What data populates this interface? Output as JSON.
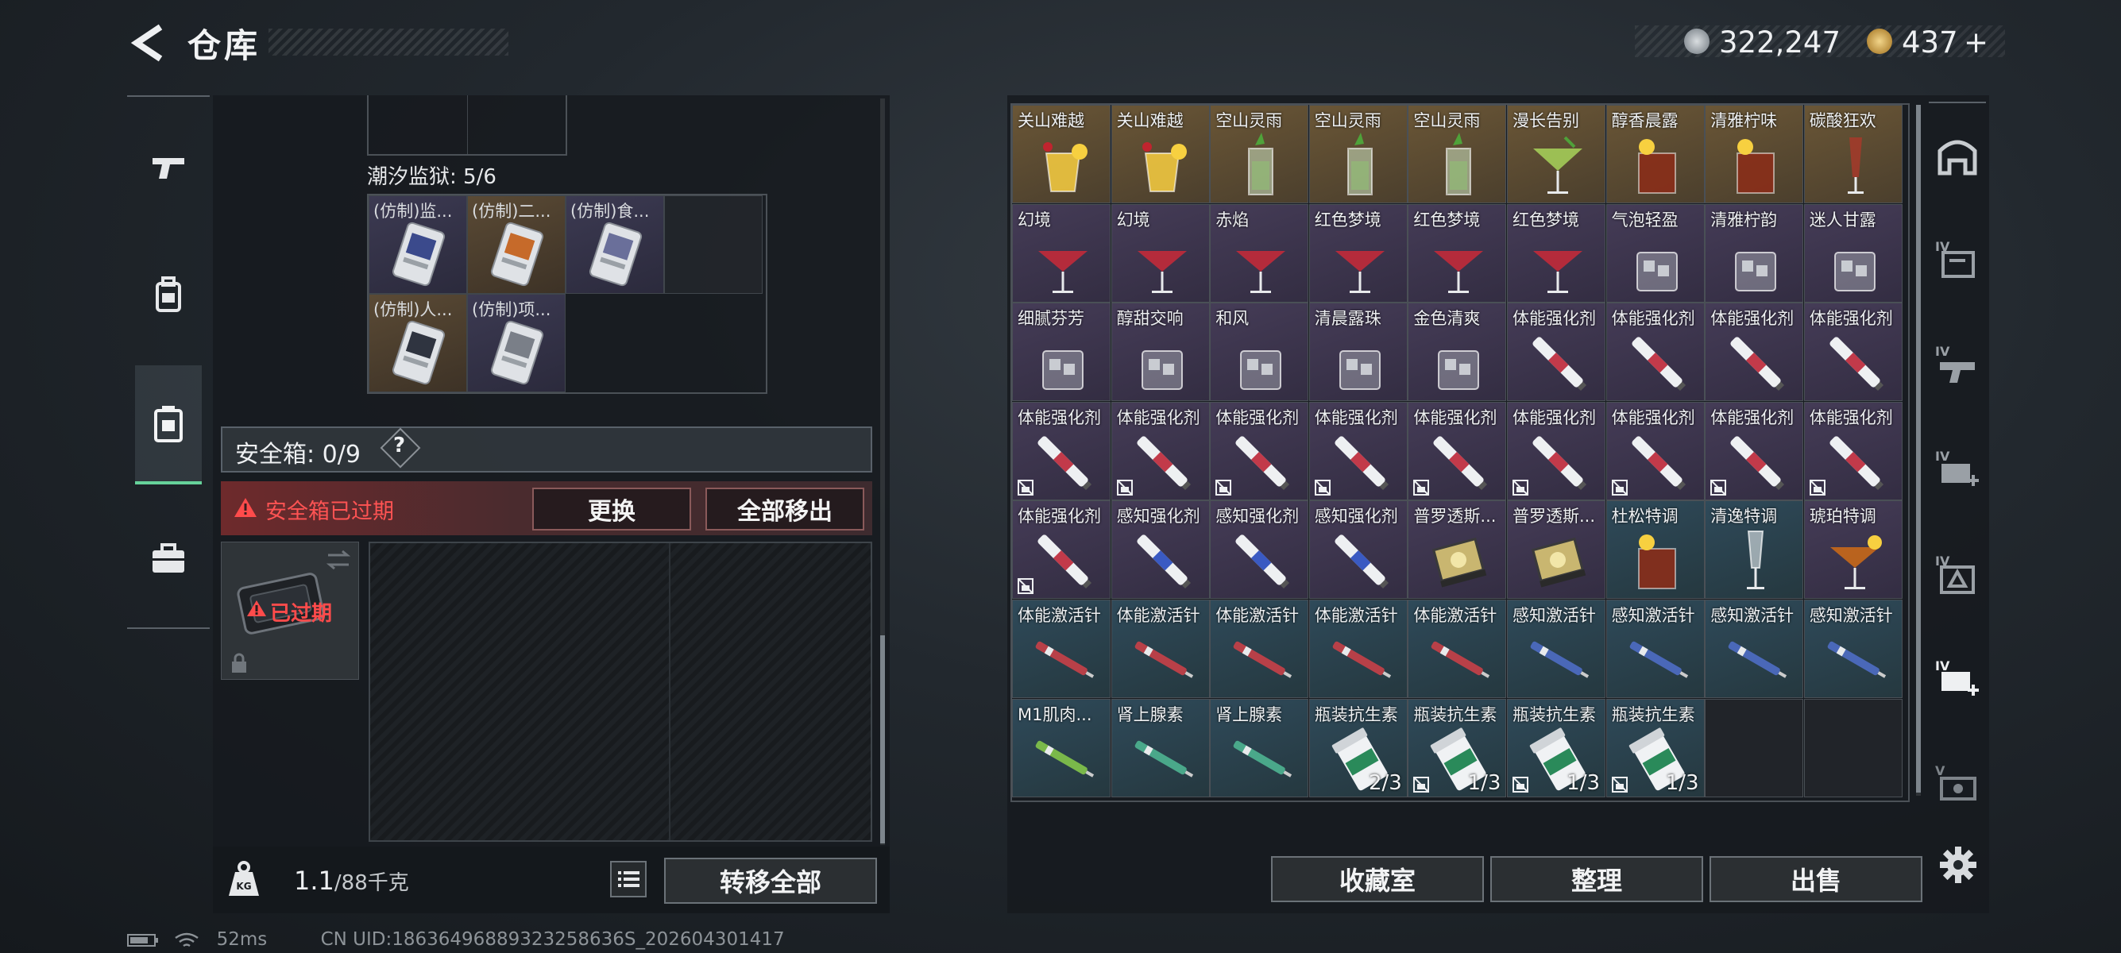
{
  "header": {
    "title": "仓库",
    "currency_silver": "322,247",
    "currency_gold": "437",
    "currency_add": "+"
  },
  "left_rail": {
    "items": [
      "weapon-icon",
      "backpack-icon",
      "container-icon",
      "briefcase-icon"
    ]
  },
  "left_panel": {
    "prison_label": "潮汐监狱: 5/6",
    "prison_items": [
      {
        "label": "(仿制)监..."
      },
      {
        "label": "(仿制)二..."
      },
      {
        "label": "(仿制)食..."
      },
      {
        "label": "(仿制)人..."
      },
      {
        "label": "(仿制)项..."
      }
    ],
    "safebox_label": "安全箱: 0/9",
    "safebox_help": "?",
    "expired_warning": "安全箱已过期",
    "replace_button": "更换",
    "remove_all_button": "全部移出",
    "case_status": "已过期",
    "weight": "1.1",
    "weight_capacity": "/88千克",
    "transfer_all_button": "转移全部"
  },
  "status_bar": {
    "ping": "52ms",
    "uid": "CN UID:18636496889323258636S_202604301417"
  },
  "right_panel": {
    "collection_button": "收藏室",
    "organize_button": "整理",
    "sell_button": "出售",
    "items": [
      {
        "label": "关山难越",
        "rarity": "gold",
        "art": "cocktail-yellow"
      },
      {
        "label": "关山难越",
        "rarity": "gold",
        "art": "cocktail-yellow"
      },
      {
        "label": "空山灵雨",
        "rarity": "gold",
        "art": "mojito"
      },
      {
        "label": "空山灵雨",
        "rarity": "gold",
        "art": "mojito"
      },
      {
        "label": "空山灵雨",
        "rarity": "gold",
        "art": "mojito"
      },
      {
        "label": "漫长告别",
        "rarity": "gold",
        "art": "martini-green"
      },
      {
        "label": "醇香晨露",
        "rarity": "gold",
        "art": "tumbler-amber"
      },
      {
        "label": "清雅柠味",
        "rarity": "gold",
        "art": "tumbler-amber"
      },
      {
        "label": "碳酸狂欢",
        "rarity": "gold",
        "art": "tall-glass"
      },
      {
        "label": "幻境",
        "rarity": "purple",
        "art": "martini-red"
      },
      {
        "label": "幻境",
        "rarity": "purple",
        "art": "martini-red"
      },
      {
        "label": "赤焰",
        "rarity": "purple",
        "art": "martini-red"
      },
      {
        "label": "红色梦境",
        "rarity": "purple",
        "art": "martini-red"
      },
      {
        "label": "红色梦境",
        "rarity": "purple",
        "art": "martini-red"
      },
      {
        "label": "红色梦境",
        "rarity": "purple",
        "art": "martini-red"
      },
      {
        "label": "气泡轻盈",
        "rarity": "purple",
        "art": "rocks-glass"
      },
      {
        "label": "清雅柠韵",
        "rarity": "purple",
        "art": "rocks-glass"
      },
      {
        "label": "迷人甘露",
        "rarity": "purple",
        "art": "rocks-glass"
      },
      {
        "label": "细腻芬芳",
        "rarity": "purple",
        "art": "rocks-glass"
      },
      {
        "label": "醇甜交响",
        "rarity": "purple",
        "art": "rocks-glass"
      },
      {
        "label": "和风",
        "rarity": "purple",
        "art": "rocks-glass"
      },
      {
        "label": "清晨露珠",
        "rarity": "purple",
        "art": "rocks-glass"
      },
      {
        "label": "金色清爽",
        "rarity": "purple",
        "art": "rocks-glass"
      },
      {
        "label": "体能强化剂",
        "rarity": "purple",
        "art": "injector-red"
      },
      {
        "label": "体能强化剂",
        "rarity": "purple",
        "art": "injector-red"
      },
      {
        "label": "体能强化剂",
        "rarity": "purple",
        "art": "injector-red"
      },
      {
        "label": "体能强化剂",
        "rarity": "purple",
        "art": "injector-red"
      },
      {
        "label": "体能强化剂",
        "rarity": "purple",
        "art": "injector-red",
        "locked": true
      },
      {
        "label": "体能强化剂",
        "rarity": "purple",
        "art": "injector-red",
        "locked": true
      },
      {
        "label": "体能强化剂",
        "rarity": "purple",
        "art": "injector-red",
        "locked": true
      },
      {
        "label": "体能强化剂",
        "rarity": "purple",
        "art": "injector-red",
        "locked": true
      },
      {
        "label": "体能强化剂",
        "rarity": "purple",
        "art": "injector-red",
        "locked": true
      },
      {
        "label": "体能强化剂",
        "rarity": "purple",
        "art": "injector-red",
        "locked": true
      },
      {
        "label": "体能强化剂",
        "rarity": "purple",
        "art": "injector-red",
        "locked": true
      },
      {
        "label": "体能强化剂",
        "rarity": "purple",
        "art": "injector-red",
        "locked": true
      },
      {
        "label": "体能强化剂",
        "rarity": "purple",
        "art": "injector-red",
        "locked": true
      },
      {
        "label": "体能强化剂",
        "rarity": "purple",
        "art": "injector-red",
        "locked": true
      },
      {
        "label": "感知强化剂",
        "rarity": "purple",
        "art": "injector-blue"
      },
      {
        "label": "感知强化剂",
        "rarity": "purple",
        "art": "injector-blue"
      },
      {
        "label": "感知强化剂",
        "rarity": "purple",
        "art": "injector-blue"
      },
      {
        "label": "普罗透斯...",
        "rarity": "purple",
        "art": "device"
      },
      {
        "label": "普罗透斯...",
        "rarity": "purple",
        "art": "device"
      },
      {
        "label": "杜松特调",
        "rarity": "blue",
        "art": "tumbler-amber"
      },
      {
        "label": "清逸特调",
        "rarity": "blue",
        "art": "flute"
      },
      {
        "label": "琥珀特调",
        "rarity": "purple",
        "art": "martini-amber"
      },
      {
        "label": "体能激活针",
        "rarity": "blue",
        "art": "syringe-red"
      },
      {
        "label": "体能激活针",
        "rarity": "blue",
        "art": "syringe-red"
      },
      {
        "label": "体能激活针",
        "rarity": "blue",
        "art": "syringe-red"
      },
      {
        "label": "体能激活针",
        "rarity": "blue",
        "art": "syringe-red"
      },
      {
        "label": "体能激活针",
        "rarity": "blue",
        "art": "syringe-red"
      },
      {
        "label": "感知激活针",
        "rarity": "blue",
        "art": "syringe-blue"
      },
      {
        "label": "感知激活针",
        "rarity": "blue",
        "art": "syringe-blue"
      },
      {
        "label": "感知激活针",
        "rarity": "blue",
        "art": "syringe-blue"
      },
      {
        "label": "感知激活针",
        "rarity": "blue",
        "art": "syringe-blue"
      },
      {
        "label": "M1肌肉...",
        "rarity": "blue",
        "art": "syringe-green"
      },
      {
        "label": "肾上腺素",
        "rarity": "blue",
        "art": "syringe-teal"
      },
      {
        "label": "肾上腺素",
        "rarity": "blue",
        "art": "syringe-teal"
      },
      {
        "label": "瓶装抗生素",
        "rarity": "blue",
        "art": "pill-bottle",
        "count": "2/3"
      },
      {
        "label": "瓶装抗生素",
        "rarity": "blue",
        "art": "pill-bottle",
        "count": "1/3",
        "locked": true
      },
      {
        "label": "瓶装抗生素",
        "rarity": "blue",
        "art": "pill-bottle",
        "count": "1/3",
        "locked": true
      },
      {
        "label": "瓶装抗生素",
        "rarity": "blue",
        "art": "pill-bottle",
        "count": "1/3",
        "locked": true
      }
    ]
  },
  "right_rail": {
    "items": [
      "safehouse-icon",
      "category-1-icon",
      "category-2-icon",
      "category-3-icon",
      "category-4-icon",
      "category-5-icon",
      "category-6-icon",
      "settings-icon"
    ]
  },
  "colors": {
    "accent_green": "#66d29a",
    "warning_red": "#ff5353",
    "gold_rarity": "#6a5636",
    "purple_rarity": "#453c57",
    "blue_rarity": "#2f4a5a"
  }
}
